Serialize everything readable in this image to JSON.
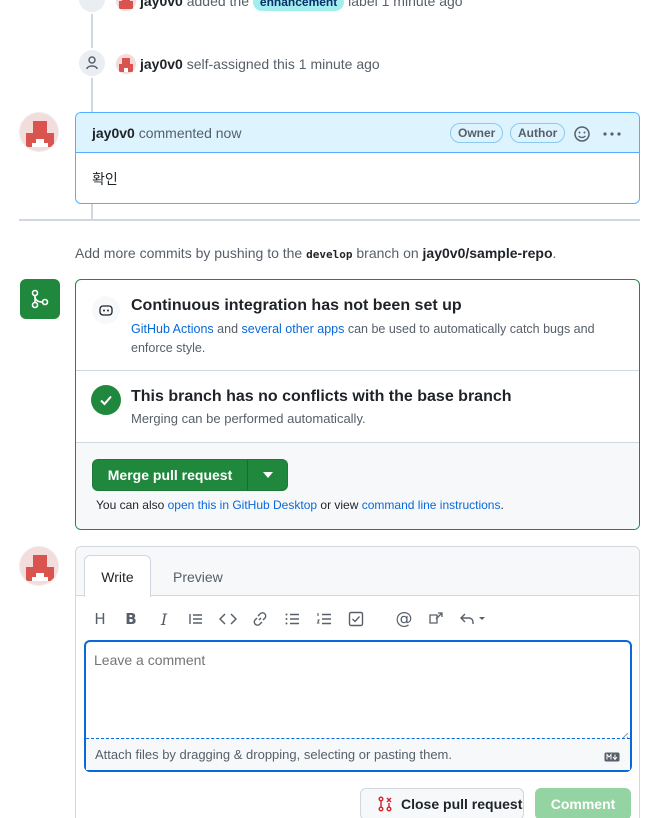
{
  "timeline": {
    "label_event": {
      "actor": "jay0v0",
      "action": "added the",
      "label": "enhancement",
      "suffix": "label 1 minute ago"
    },
    "assign_event": {
      "actor": "jay0v0",
      "action": "self-assigned this 1 minute ago"
    }
  },
  "comment": {
    "author": "jay0v0",
    "meta": "commented now",
    "badges": [
      "Owner",
      "Author"
    ],
    "body": "확인"
  },
  "push_hint": {
    "prefix": "Add more commits by pushing to the",
    "branch": "develop",
    "middle": "branch on",
    "repo": "jay0v0/sample-repo",
    "end": "."
  },
  "merge": {
    "ci_title": "Continuous integration has not been set up",
    "ci_link1": "GitHub Actions",
    "ci_and": "and",
    "ci_link2": "several other apps",
    "ci_rest": "can be used to automatically catch bugs and",
    "ci_rest2": "enforce style.",
    "conflict_title": "This branch has no conflicts with the base branch",
    "conflict_sub": "Merging can be performed automatically.",
    "merge_button": "Merge pull request",
    "also_prefix": "You can also",
    "also_link1": "open this in GitHub Desktop",
    "also_mid": "or view",
    "also_link2": "command line instructions",
    "also_end": "."
  },
  "composer": {
    "tabs": [
      "Write",
      "Preview"
    ],
    "placeholder": "Leave a comment",
    "attach_hint": "Attach files by dragging & dropping, selecting or pasting them.",
    "close_button": "Close pull request",
    "comment_button": "Comment"
  },
  "colors": {
    "accent": "#0969da",
    "merge_green": "#1f883d",
    "comment_head": "#ddf4ff",
    "label_bg": "#a2eeef"
  }
}
